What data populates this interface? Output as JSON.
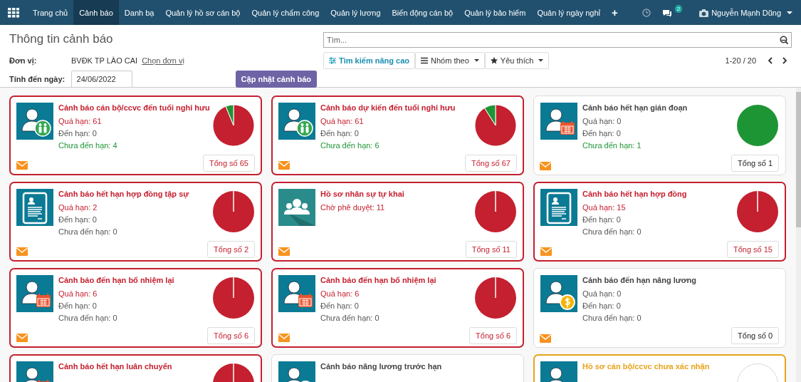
{
  "navbar": {
    "menu": [
      {
        "label": "Trang chủ",
        "selected": false
      },
      {
        "label": "Cảnh báo",
        "selected": true
      },
      {
        "label": "Danh bạ",
        "selected": false
      },
      {
        "label": "Quản lý hồ sơ cán bộ",
        "selected": false
      },
      {
        "label": "Quản lý chấm công",
        "selected": false
      },
      {
        "label": "Quản lý lương",
        "selected": false
      },
      {
        "label": "Biến động cán bộ",
        "selected": false
      },
      {
        "label": "Quản lý bảo hiểm",
        "selected": false
      },
      {
        "label": "Quản lý ngày nghỉ",
        "selected": false
      }
    ],
    "add": "+",
    "chat_badge": "2",
    "user": "Nguyễn Mạnh Dũng"
  },
  "control_panel": {
    "title": "Thông tin cảnh báo",
    "unit_label": "Đơn vị:",
    "unit_value": "BVĐK TP LÀO CAI",
    "unit_link": "Chọn đơn vị",
    "date_label": "Tính đến ngày:",
    "date_value": "24/06/2022",
    "update_button": "Cập nhật cảnh báo",
    "search": {
      "placeholder": "Tìm..."
    },
    "filters": [
      "Tìm kiếm nâng cao",
      "Nhóm theo",
      "Yêu thích"
    ],
    "pager": "1-20 / 20"
  },
  "cards": [
    {
      "kind": "pie",
      "color": "#c4202f",
      "title": "Cảnh báo cán bộ/ccvc đến tuổi nghỉ hưu",
      "lines": [
        {
          "text": "Quá hạn: 61",
          "color": "#c4202f"
        },
        {
          "text": "Đến hạn: 0",
          "color": "#555555"
        },
        {
          "text": "Chưa đến hạn: 4",
          "color": "#1e9535"
        }
      ],
      "total": "Tổng số 65"
    },
    {
      "kind": "pie",
      "color": "#c4202f",
      "title": "Cảnh báo dự kiến đến tuổi nghỉ hưu",
      "lines": [
        {
          "text": "Quá hạn: 61",
          "color": "#c4202f"
        },
        {
          "text": "Đến hạn: 0",
          "color": "#555555"
        },
        {
          "text": "Chưa đến hạn: 6",
          "color": "#1e9535"
        }
      ],
      "total": "Tổng số 67"
    },
    {
      "kind": "pie",
      "color": "#dcdcdc",
      "title": "Cảnh báo hết hạn gián đoạn",
      "lines": [
        {
          "text": "Quá hạn: 0",
          "color": "#555555"
        },
        {
          "text": "Đến hạn: 0",
          "color": "#555555"
        },
        {
          "text": "Chưa đến hạn: 1",
          "color": "#1e9535"
        }
      ],
      "total": "Tổng số 1"
    },
    {
      "kind": "pie",
      "color": "#c4202f",
      "title": "Cảnh báo hết hạn hợp đồng tập sự",
      "lines": [
        {
          "text": "Quá hạn: 2",
          "color": "#c4202f"
        },
        {
          "text": "Đến hạn: 0",
          "color": "#555555"
        },
        {
          "text": "Chưa đến hạn: 0",
          "color": "#555555"
        }
      ],
      "total": "Tổng số 2"
    },
    {
      "kind": "pie",
      "color": "#c4202f",
      "title": "Hồ sơ nhân sự tự khai",
      "lines": [
        {
          "text": "Chờ phê duyệt: 11",
          "color": "#c4202f"
        }
      ],
      "total": "Tổng số 11"
    },
    {
      "kind": "pie",
      "color": "#c4202f",
      "title": "Cảnh báo hết hạn hợp đồng",
      "lines": [
        {
          "text": "Quá hạn: 15",
          "color": "#c4202f"
        },
        {
          "text": "Đến hạn: 0",
          "color": "#555555"
        },
        {
          "text": "Chưa đến hạn: 0",
          "color": "#555555"
        }
      ],
      "total": "Tổng số 15"
    },
    {
      "kind": "pie",
      "color": "#c4202f",
      "title": "Cảnh báo đến hạn bổ nhiệm lại",
      "lines": [
        {
          "text": "Quá hạn: 6",
          "color": "#c4202f"
        },
        {
          "text": "Đến hạn: 0",
          "color": "#555555"
        },
        {
          "text": "Chưa đến hạn: 0",
          "color": "#555555"
        }
      ],
      "total": "Tổng số 6"
    },
    {
      "kind": "pie",
      "color": "#c4202f",
      "title": "Cảnh báo đến hạn bổ nhiệm lại",
      "lines": [
        {
          "text": "Quá hạn: 6",
          "color": "#c4202f"
        },
        {
          "text": "Đến hạn: 0",
          "color": "#555555"
        },
        {
          "text": "Chưa đến hạn: 0",
          "color": "#555555"
        }
      ],
      "total": "Tổng số 6"
    },
    {
      "kind": "pie",
      "color": "#dcdcdc",
      "title": "Cảnh báo đến hạn nâng lương",
      "lines": [
        {
          "text": "Quá hạn: 0",
          "color": "#555555"
        },
        {
          "text": "Đến hạn: 0",
          "color": "#555555"
        },
        {
          "text": "Chưa đến hạn: 0",
          "color": "#555555"
        }
      ],
      "total": "Tổng số 0"
    },
    {
      "kind": "full",
      "color": "#c4202f",
      "title": "Cảnh báo hết hạn luân chuyển"
    },
    {
      "kind": "none",
      "color": "#dcdcdc",
      "title": "Cảnh báo nâng lương trước hạn"
    },
    {
      "kind": "ring",
      "color": "#e8a31b",
      "title": "Hồ sơ cán bộ/ccvc chưa xác nhận"
    }
  ]
}
